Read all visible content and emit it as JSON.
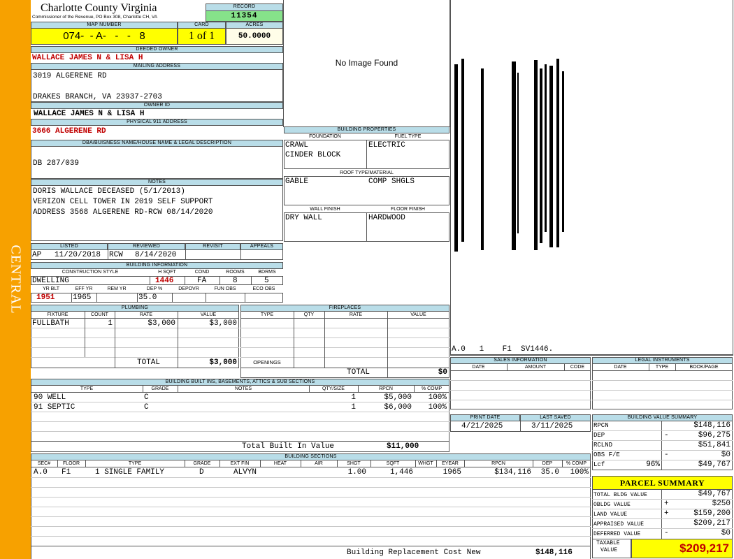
{
  "sidebar_label": "CENTRAL",
  "header": {
    "county": "Charlotte County Virginia",
    "commissioner": "Commissioner of the Revenue, PO Box 308, Charlotte CH, VA",
    "record_label": "RECORD",
    "record": "11354",
    "map_label": "MAP NUMBER",
    "map_number": "074-  - A-   -   -   8",
    "card_label": "CARD",
    "card": "1 of 1",
    "acres_label": "ACRES",
    "acres": "50.0000"
  },
  "owner": {
    "deeded_label": "DEEDED OWNER",
    "deeded": "WALLACE JAMES N & LISA H",
    "mailing_label": "MAILING ADDRESS",
    "mailing_line1": "3019 ALGERENE RD",
    "mailing_line2": "DRAKES BRANCH, VA 23937-2703",
    "owner_id_label": "OWNER ID",
    "owner_id": "WALLACE JAMES N & LISA H",
    "physical_label": "PHYSICAL 911 ADDRESS",
    "physical": "3666 ALGERENE RD"
  },
  "dba": {
    "label": "DBA/BUISNESS NAME/HOUSE NAME & LEGAL DESCRIPTION",
    "value": "DB 287/039"
  },
  "notes": {
    "label": "NOTES",
    "lines": [
      "DORIS WALLACE DECEASED (5/1/2013)",
      "VERIZON CELL TOWER IN 2019 SELF SUPPORT",
      "ADDRESS 3568 ALGERENE RD-RCW 08/14/2020"
    ]
  },
  "listing": {
    "listed_label": "LISTED",
    "listed_by": "AP",
    "listed_date": "11/20/2018",
    "reviewed_label": "REVIEWED",
    "reviewed_by": "RCW",
    "reviewed_date": "8/14/2020",
    "revisit_label": "REVISIT",
    "appeals_label": "APPEALS"
  },
  "building_info": {
    "label": "BUILDING INFORMATION",
    "style_label": "CONSTRUCTION STYLE",
    "style": "DWELLING",
    "hsqft_label": "H SQFT",
    "hsqft": "1446",
    "cond_label": "COND",
    "cond": "FA",
    "rooms_label": "ROOMS",
    "rooms": "8",
    "bdrms_label": "BDRMS",
    "bdrms": "5",
    "yrblt_label": "YR BLT",
    "yrblt": "1951",
    "effyr_label": "EFF YR",
    "effyr": "1965",
    "remyr_label": "REM YR",
    "remyr": "",
    "dep_label": "DEP %",
    "dep": "35.0",
    "depovr_label": "DEPOVR",
    "funobs_label": "FUN OBS",
    "ecoobs_label": "ECO OBS"
  },
  "image_text": "No Image Found",
  "building_properties": {
    "label": "BUILDING PROPERTIES",
    "foundation_label": "FOUNDATION",
    "foundation1": "CRAWL",
    "foundation2": "CINDER BLOCK",
    "fuel_label": "FUEL TYPE",
    "fuel": "ELECTRIC",
    "roof_label": "ROOF TYPE/MATERIAL",
    "roof_type": "GABLE",
    "roof_material": "COMP SHGLS",
    "wall_label": "WALL FINISH",
    "wall": "DRY WALL",
    "floor_label": "FLOOR FINISH",
    "floor": "HARDWOOD"
  },
  "sketch_label": "A.0   1    F1  SV1446.",
  "plumbing": {
    "label": "PLUMBING",
    "headers": [
      "FIXTURE",
      "COUNT",
      "RATE",
      "VALUE"
    ],
    "rows": [
      {
        "fixture": "FULLBATH",
        "count": "1",
        "rate": "$3,000",
        "value": "$3,000"
      }
    ],
    "total_label": "TOTAL",
    "total": "$3,000"
  },
  "fireplaces": {
    "label": "FIREPLACES",
    "headers": [
      "TYPE",
      "QTY",
      "RATE",
      "VALUE"
    ],
    "openings_label": "OPENINGS",
    "total_label": "TOTAL",
    "total": "$0"
  },
  "builtins": {
    "label": "BUILDING BUILT INS, BASEMENTS, ATTICS & SUB SECTIONS",
    "headers": [
      "TYPE",
      "GRADE",
      "NOTES",
      "QTY/SIZE",
      "RPCN",
      "% COMP"
    ],
    "rows": [
      {
        "type": "90 WELL",
        "grade": "C",
        "qty": "1",
        "rpcn": "$5,000",
        "comp": "100%"
      },
      {
        "type": "91 SEPTIC",
        "grade": "C",
        "qty": "1",
        "rpcn": "$6,000",
        "comp": "100%"
      }
    ],
    "total_label": "Total Built In Value",
    "total": "$11,000"
  },
  "sales": {
    "label": "SALES INFORMATION",
    "headers": [
      "DATE",
      "AMOUNT",
      "CODE"
    ]
  },
  "legal": {
    "label": "LEGAL INSTRUMENTS",
    "headers": [
      "DATE",
      "TYPE",
      "BOOK/PAGE"
    ]
  },
  "dates": {
    "print_label": "PRINT DATE",
    "print": "4/21/2025",
    "saved_label": "LAST SAVED",
    "saved": "3/11/2025"
  },
  "building_sections": {
    "label": "BUILDING SECTIONS",
    "headers": [
      "SEC#",
      "FLOOR",
      "TYPE",
      "GRADE",
      "EXT FIN",
      "HEAT",
      "AIR",
      "SHGT",
      "SQFT",
      "WHGT",
      "EYEAR",
      "RPCN",
      "DEP",
      "% COMP"
    ],
    "rows": [
      {
        "sec": "A.0",
        "floor": "F1",
        "type": "1 SINGLE FAMILY",
        "grade": "D",
        "extfin": "ALVYN",
        "shgt": "1.00",
        "sqft": "1,446",
        "eyear": "1965",
        "rpcn": "$134,116",
        "dep": "35.0",
        "comp": "100%"
      }
    ],
    "total_label": "Building Replacement Cost New",
    "total": "$148,116"
  },
  "value_summary": {
    "label": "BUILDING VALUE SUMMARY",
    "rpcn_label": "RPCN",
    "rpcn": "$148,116",
    "dep_label": "DEP",
    "dep_sign": "-",
    "dep": "$96,275",
    "rclnd_label": "RCLND",
    "rclnd": "$51,841",
    "obs_label": "OBS F/E",
    "obs_sign": "-",
    "obs": "$0",
    "lcf_label": "Lcf",
    "lcf_pct": "96%",
    "lcf": "$49,767"
  },
  "parcel_summary": {
    "label": "PARCEL SUMMARY",
    "bldg_label": "TOTAL BLDG VALUE",
    "bldg": "$49,767",
    "obldg_label": "OBLDG VALUE",
    "obldg_sign": "+",
    "obldg": "$250",
    "land_label": "LAND VALUE",
    "land_sign": "+",
    "land": "$159,200",
    "appraised_label": "APPRAISED VALUE",
    "appraised": "$209,217",
    "deferred_label": "DEFERRED VALUE",
    "deferred_sign": "-",
    "deferred": "$0",
    "taxable_label1": "TAXABLE",
    "taxable_label2": "VALUE",
    "taxable": "$209,217"
  },
  "colors": {
    "sidebar": "#f7a100",
    "header_fill": "#b9dde8",
    "yellow": "#ffff00",
    "record_green": "#86e28a",
    "red": "#c00000"
  }
}
